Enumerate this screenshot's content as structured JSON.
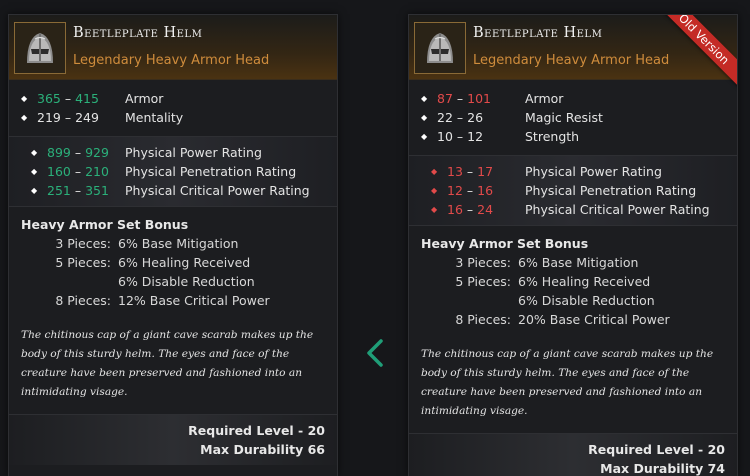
{
  "colors": {
    "better": "#2bb07a",
    "worse": "#e24a4a",
    "type": "#cf8c3c",
    "ribbon": "#c42b26"
  },
  "left": {
    "name": "Beetleplate Helm",
    "type": "Legendary Heavy Armor Head",
    "base_stats": [
      {
        "lo": "365",
        "hi": "415",
        "name": "Armor",
        "color": "green"
      },
      {
        "lo": "219",
        "hi": "249",
        "name": "Mentality",
        "color": "white"
      }
    ],
    "ratings": [
      {
        "lo": "899",
        "hi": "929",
        "name": "Physical Power Rating",
        "color": "green"
      },
      {
        "lo": "160",
        "hi": "210",
        "name": "Physical Penetration Rating",
        "color": "green"
      },
      {
        "lo": "251",
        "hi": "351",
        "name": "Physical Critical Power Rating",
        "color": "green"
      }
    ],
    "set_title": "Heavy Armor Set Bonus",
    "set_rows": [
      {
        "pieces": "3 Pieces:",
        "bonus": "6% Base Mitigation"
      },
      {
        "pieces": "5 Pieces:",
        "bonus": "6% Healing Received"
      },
      {
        "pieces": "",
        "bonus": "6% Disable Reduction"
      },
      {
        "pieces": "8 Pieces:",
        "bonus": "12% Base Critical Power"
      }
    ],
    "flavor": "The chitinous cap of a giant cave scarab makes up the body of this sturdy helm. The eyes and face of the creature have been preserved and fashioned into an intimidating visage.",
    "required_level": "Required Level - 20",
    "max_durability": "Max Durability 66"
  },
  "right": {
    "name": "Beetleplate Helm",
    "type": "Legendary Heavy Armor Head",
    "ribbon": "Old Version",
    "base_stats": [
      {
        "lo": "87",
        "hi": "101",
        "name": "Armor",
        "color": "red"
      },
      {
        "lo": "22",
        "hi": "26",
        "name": "Magic Resist",
        "color": "white"
      },
      {
        "lo": "10",
        "hi": "12",
        "name": "Strength",
        "color": "white"
      }
    ],
    "ratings": [
      {
        "lo": "13",
        "hi": "17",
        "name": "Physical Power Rating",
        "color": "red"
      },
      {
        "lo": "12",
        "hi": "16",
        "name": "Physical Penetration Rating",
        "color": "red"
      },
      {
        "lo": "16",
        "hi": "24",
        "name": "Physical Critical Power Rating",
        "color": "red"
      }
    ],
    "set_title": "Heavy Armor Set Bonus",
    "set_rows": [
      {
        "pieces": "3 Pieces:",
        "bonus": "6% Base Mitigation"
      },
      {
        "pieces": "5 Pieces:",
        "bonus": "6% Healing Received"
      },
      {
        "pieces": "",
        "bonus": "6% Disable Reduction"
      },
      {
        "pieces": "8 Pieces:",
        "bonus": "20% Base Critical Power"
      }
    ],
    "flavor": "The chitinous cap of a giant cave scarab makes up the body of this sturdy helm. The eyes and face of the creature have been preserved and fashioned into an intimidating visage.",
    "required_level": "Required Level - 20",
    "max_durability": "Max Durability 74"
  },
  "nav": {
    "icon": "chevron-left-icon"
  }
}
